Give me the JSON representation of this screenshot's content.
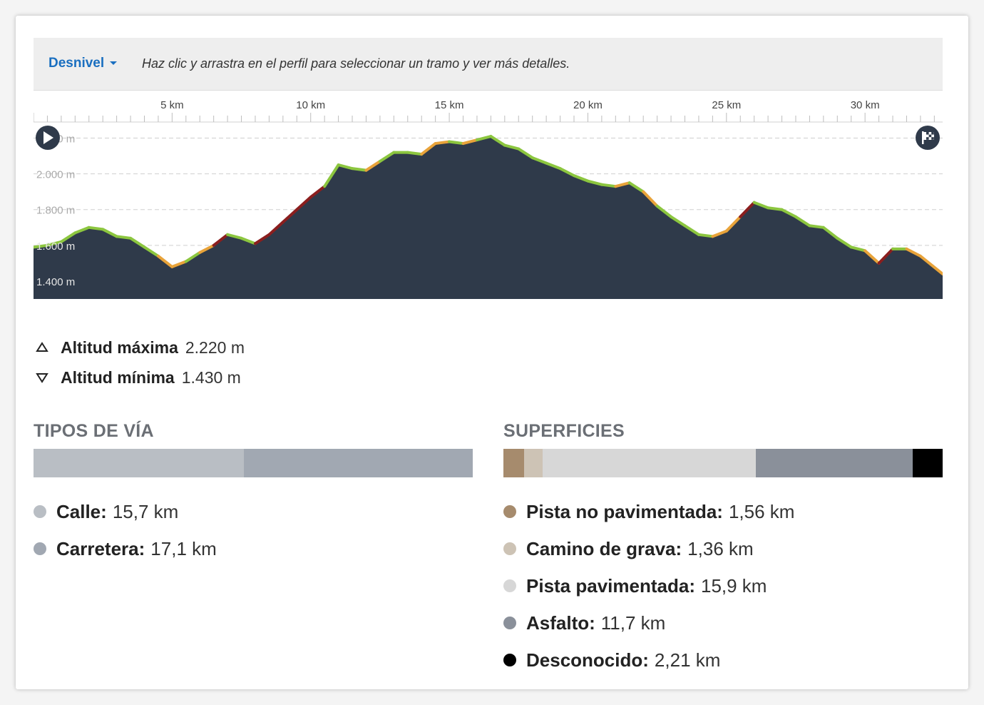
{
  "header": {
    "dropdown_label": "Desnivel",
    "hint_text": "Haz clic y arrastra en el perfil para seleccionar un tramo y ver más detalles."
  },
  "chart_data": {
    "type": "area",
    "x_unit": "km",
    "x_ticks": [
      {
        "km": 5,
        "label": "5 km"
      },
      {
        "km": 10,
        "label": "10 km"
      },
      {
        "km": 15,
        "label": "15 km"
      },
      {
        "km": 20,
        "label": "20 km"
      },
      {
        "km": 25,
        "label": "25 km"
      },
      {
        "km": 30,
        "label": "30 km"
      }
    ],
    "y_ticks": [
      {
        "m": 1400,
        "label": "1.400 m"
      },
      {
        "m": 1600,
        "label": "1.600 m"
      },
      {
        "m": 1800,
        "label": "1.800 m"
      },
      {
        "m": 2000,
        "label": "2.000 m"
      },
      {
        "m": 2200,
        "label": "2.200 m"
      }
    ],
    "xlim": [
      0,
      32.8
    ],
    "ylim": [
      1300,
      2290
    ],
    "grid": true,
    "colors": {
      "fill": "#2f3a4a",
      "grid": "#cfcfcf",
      "line_easy": "#8cc63f",
      "line_mid": "#e8a33a",
      "line_hard": "#8b1e1e"
    },
    "series": [
      {
        "x": [
          0,
          0.5,
          1.0,
          1.5,
          2.0,
          2.5,
          3.0,
          3.5,
          4.0,
          4.5,
          5.0,
          5.5,
          6.0,
          6.5,
          7.0,
          7.5,
          8.0,
          8.5,
          9.0,
          9.5,
          10.0,
          10.5,
          11.0,
          11.5,
          12.0,
          12.5,
          13.0,
          13.5,
          14.0,
          14.5,
          15.0,
          15.5,
          16.0,
          16.5,
          17.0,
          17.5,
          18.0,
          18.5,
          19.0,
          19.5,
          20.0,
          20.5,
          21.0,
          21.5,
          22.0,
          22.5,
          23.0,
          23.5,
          24.0,
          24.5,
          25.0,
          25.5,
          26.0,
          26.5,
          27.0,
          27.5,
          28.0,
          28.5,
          29.0,
          29.5,
          30.0,
          30.5,
          31.0,
          31.5,
          32.0,
          32.8
        ],
        "y": [
          1590,
          1600,
          1620,
          1670,
          1700,
          1690,
          1650,
          1640,
          1590,
          1540,
          1480,
          1510,
          1560,
          1600,
          1660,
          1640,
          1610,
          1660,
          1730,
          1800,
          1870,
          1930,
          2050,
          2030,
          2020,
          2070,
          2120,
          2120,
          2110,
          2170,
          2180,
          2170,
          2190,
          2210,
          2160,
          2140,
          2090,
          2060,
          2030,
          1990,
          1960,
          1940,
          1930,
          1950,
          1900,
          1820,
          1760,
          1710,
          1660,
          1650,
          1680,
          1760,
          1840,
          1810,
          1800,
          1760,
          1710,
          1700,
          1640,
          1590,
          1570,
          1500,
          1580,
          1580,
          1540,
          1440
        ],
        "segment_colors": [
          "easy",
          "easy",
          "easy",
          "easy",
          "easy",
          "easy",
          "easy",
          "easy",
          "easy",
          "mid",
          "mid",
          "easy",
          "mid",
          "hard",
          "easy",
          "easy",
          "hard",
          "hard",
          "hard",
          "hard",
          "hard",
          "easy",
          "easy",
          "easy",
          "mid",
          "easy",
          "easy",
          "easy",
          "mid",
          "mid",
          "easy",
          "mid",
          "easy",
          "easy",
          "easy",
          "easy",
          "easy",
          "easy",
          "easy",
          "easy",
          "easy",
          "easy",
          "mid",
          "easy",
          "mid",
          "easy",
          "easy",
          "easy",
          "easy",
          "mid",
          "mid",
          "hard",
          "easy",
          "easy",
          "easy",
          "easy",
          "easy",
          "easy",
          "easy",
          "easy",
          "mid",
          "hard",
          "easy",
          "mid",
          "mid"
        ]
      }
    ]
  },
  "stats": {
    "max_label": "Altitud máxima",
    "max_value": "2.220 m",
    "min_label": "Altitud mínima",
    "min_value": "1.430 m"
  },
  "tipos": {
    "title": "TIPOS DE VÍA",
    "items": [
      {
        "label": "Calle:",
        "value": "15,7 km",
        "km": 15.7,
        "color": "#b9bec4"
      },
      {
        "label": "Carretera:",
        "value": "17,1 km",
        "km": 17.1,
        "color": "#a1a8b2"
      }
    ]
  },
  "superficies": {
    "title": "SUPERFICIES",
    "items": [
      {
        "label": "Pista no pavimentada:",
        "value": "1,56 km",
        "km": 1.56,
        "color": "#a68b6d"
      },
      {
        "label": "Camino de grava:",
        "value": "1,36 km",
        "km": 1.36,
        "color": "#cdc3b5"
      },
      {
        "label": "Pista pavimentada:",
        "value": "15,9 km",
        "km": 15.9,
        "color": "#d7d7d7"
      },
      {
        "label": "Asfalto:",
        "value": "11,7 km",
        "km": 11.7,
        "color": "#8a909a"
      },
      {
        "label": "Desconocido:",
        "value": "2,21 km",
        "km": 2.21,
        "color": "#000000"
      }
    ]
  }
}
